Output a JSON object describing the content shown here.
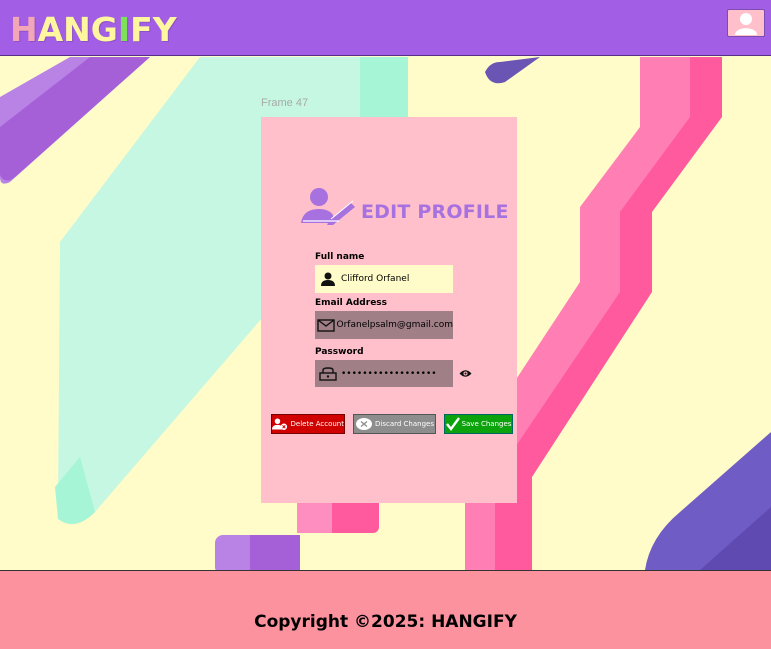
{
  "header": {
    "logo_letters": [
      {
        "char": "H",
        "color": "#f3a6b8"
      },
      {
        "char": "A",
        "color": "#fff6a0"
      },
      {
        "char": "N",
        "color": "#fff6a0"
      },
      {
        "char": "G",
        "color": "#fff6a0"
      },
      {
        "char": "I",
        "color": "#7fe05a"
      },
      {
        "char": "F",
        "color": "#fff6a0"
      },
      {
        "char": "Y",
        "color": "#fff6a0"
      }
    ],
    "avatar_icon": "user-icon"
  },
  "frame_label": "Frame 47",
  "card": {
    "title": "EDIT PROFILE",
    "title_icon": "edit-user-icon",
    "full_name": {
      "label": "Full name",
      "value": "Clifford Orfanel",
      "icon": "person-icon"
    },
    "email": {
      "label": "Email Address",
      "value": "Orfanelpsalm@gmail.com",
      "icon": "mail-icon"
    },
    "password": {
      "label": "Password",
      "value": "••••••••••••••••••",
      "icon": "lock-icon",
      "toggle_icon": "eye-icon"
    },
    "buttons": {
      "delete": "Delete Account",
      "discard": "Discard Changes",
      "save": "Save Changes"
    }
  },
  "footer": {
    "copyright": "Copyright ©2025: HANGIFY"
  },
  "colors": {
    "header_bg": "#a25ee4",
    "card_bg": "#ffc0cb",
    "footer_bg": "#fb929e",
    "title": "#a771e0",
    "delete": "#d10000",
    "discard": "#8d8d8d",
    "save": "#0ba20b"
  }
}
